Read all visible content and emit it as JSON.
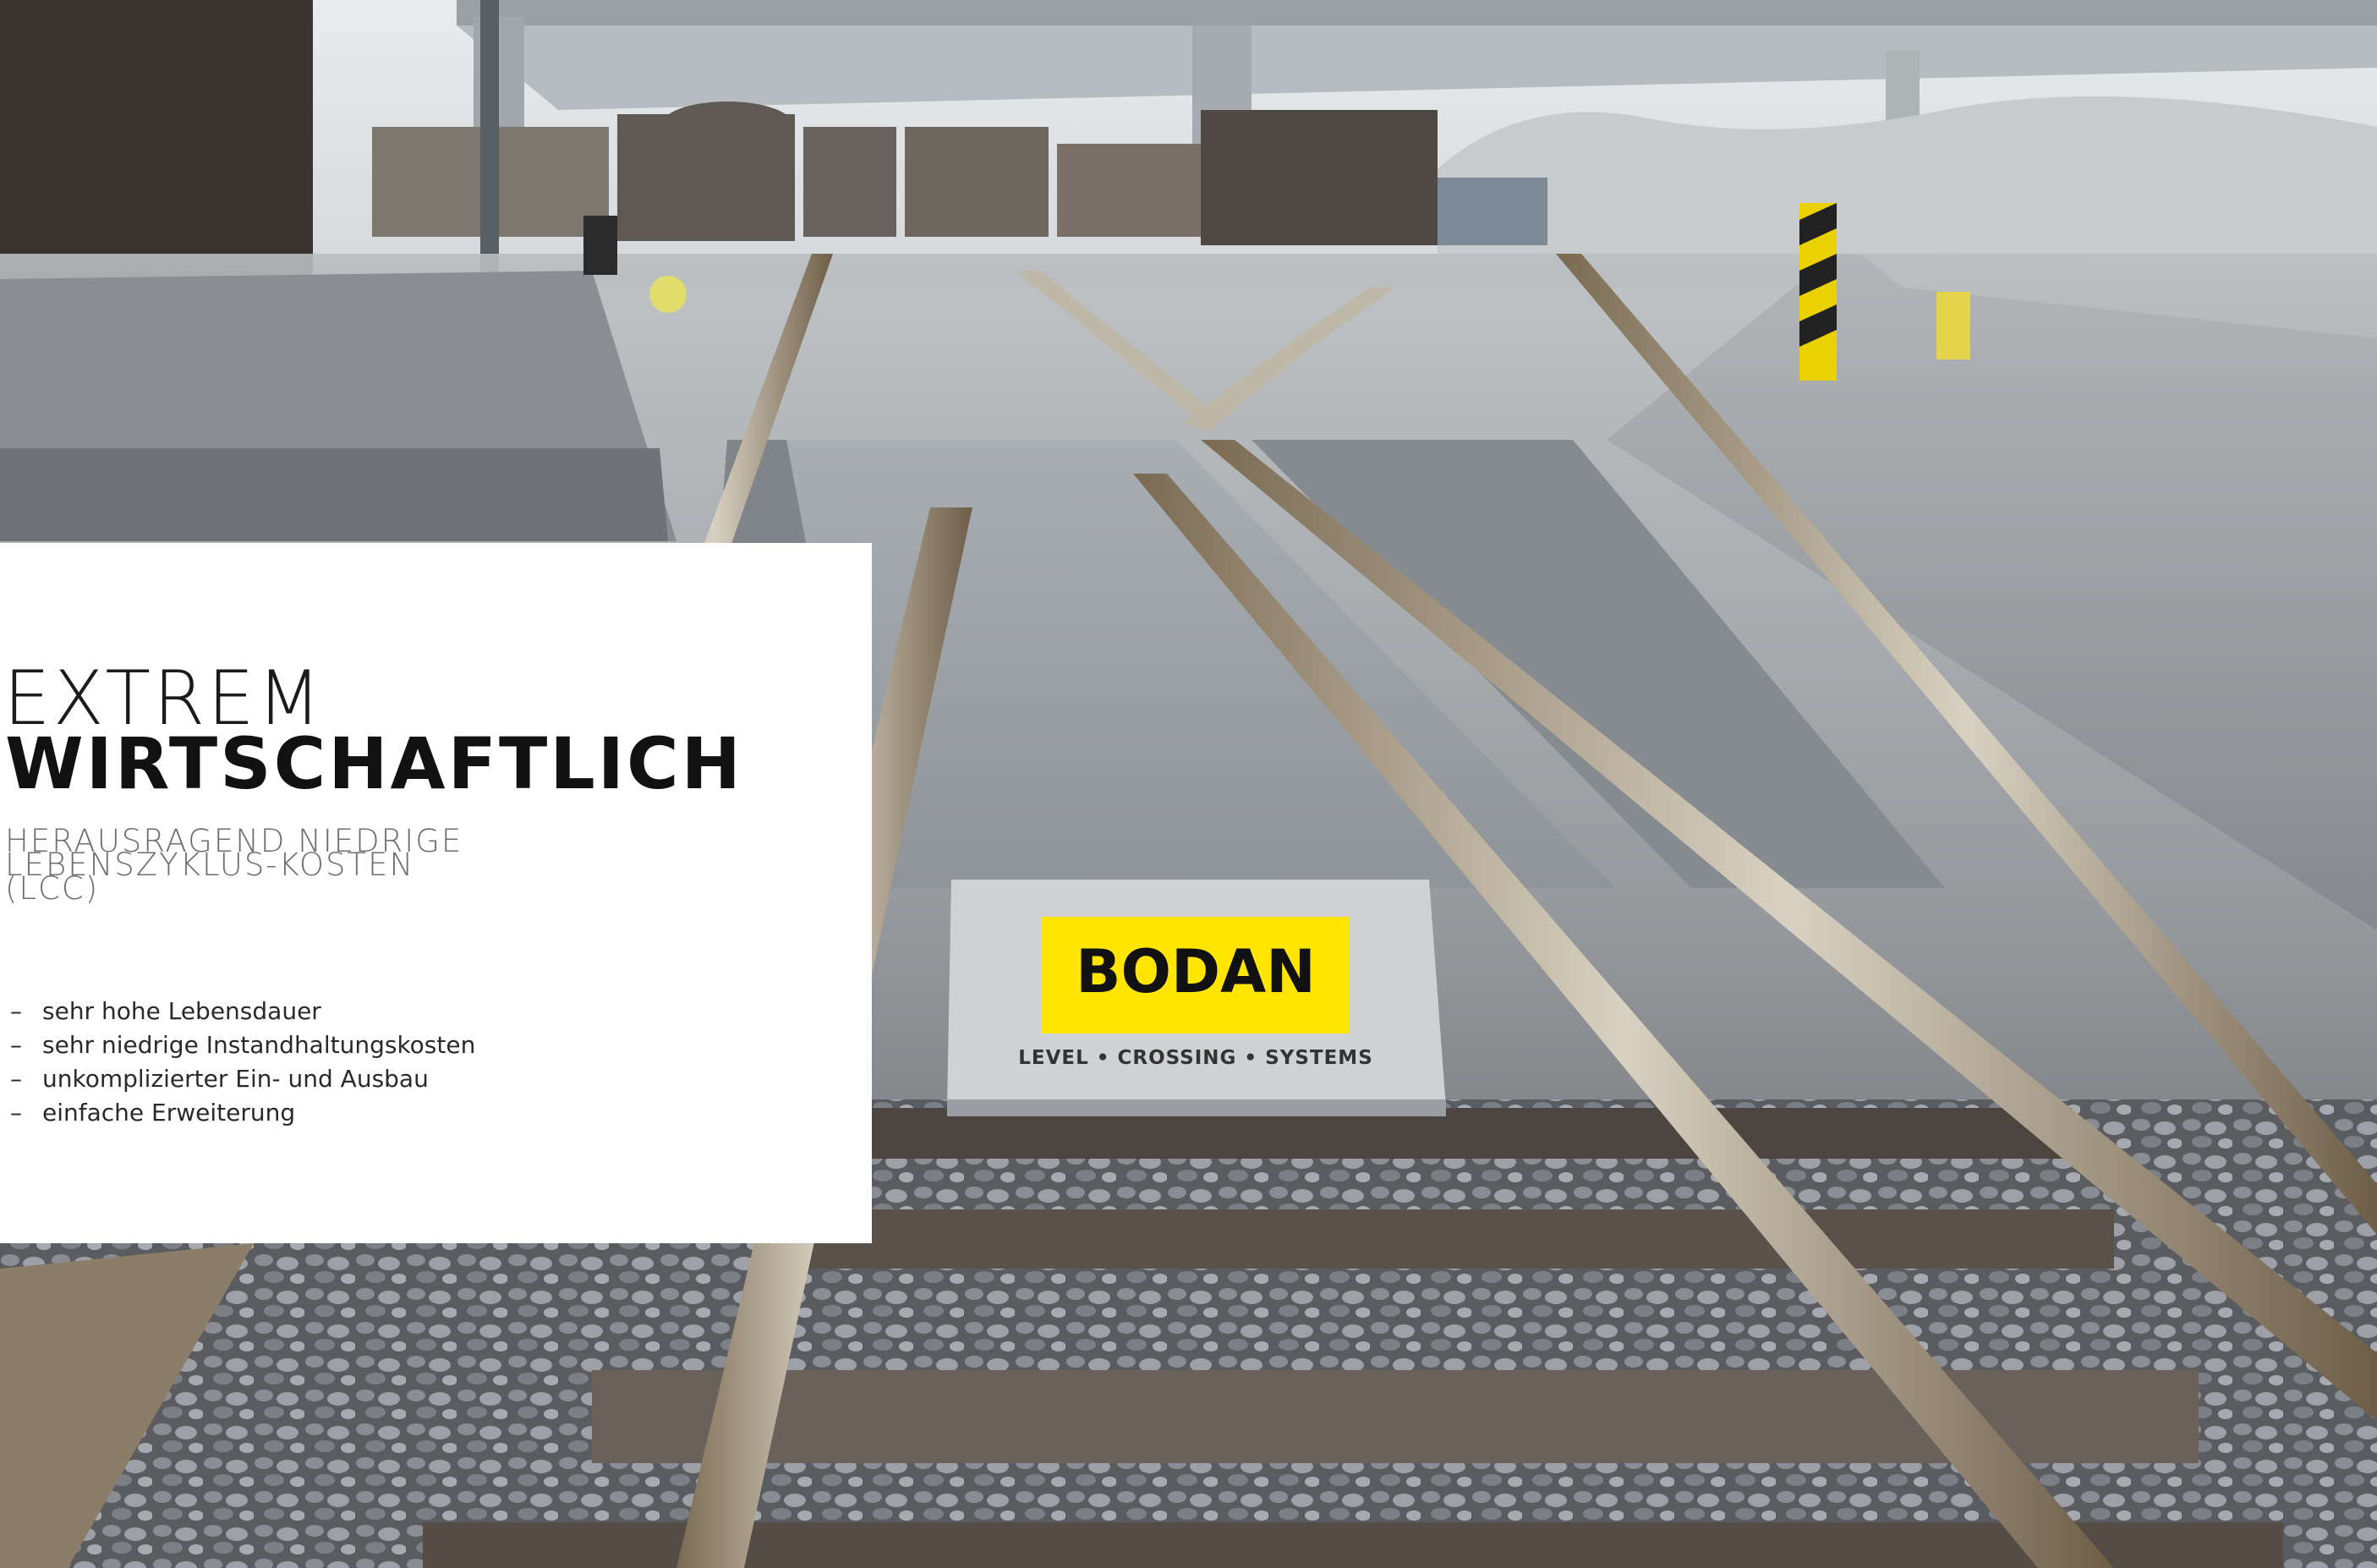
{
  "headline": {
    "light": "EXTREM",
    "bold": "WIRTSCHAFTLICH"
  },
  "subheadline": {
    "lines": [
      "HERAUSRAGEND NIEDRIGE",
      "LEBENSZYKLUS-KOSTEN",
      "(LCC)"
    ]
  },
  "bullets": [
    "sehr hohe Lebensdauer",
    "sehr niedrige Instandhaltungskosten",
    "unkomplizierter Ein- und Ausbau",
    "einfache Erweiterung"
  ],
  "bullet_marker": "–",
  "sign": {
    "brand": "BODAN",
    "tagline": "LEVEL • CROSSING • SYSTEMS"
  },
  "colors": {
    "brand_yellow": "#ffe500",
    "text_dark": "#111111",
    "text_grey": "#6e6e6e"
  }
}
